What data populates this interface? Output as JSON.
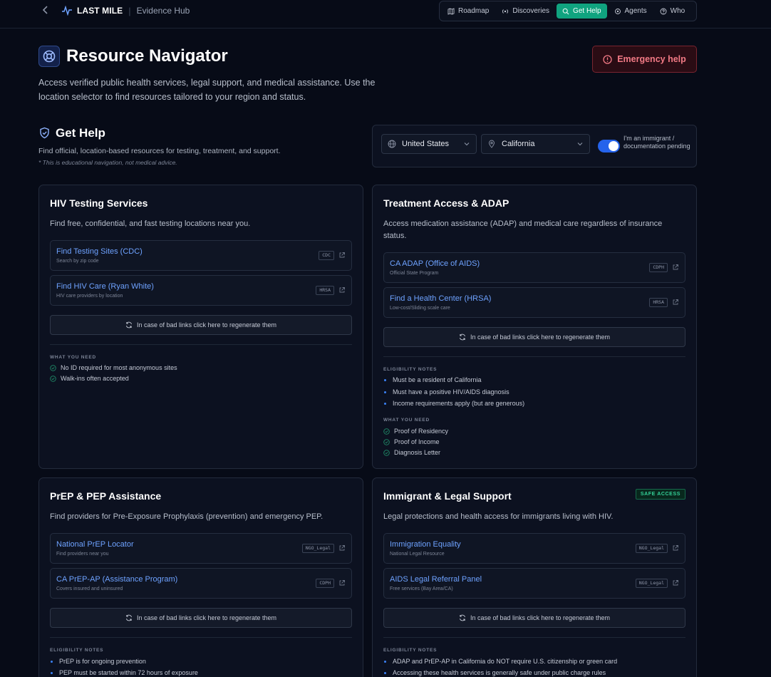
{
  "topbar": {
    "brand": "LAST MILE",
    "section": "Evidence Hub",
    "nav": [
      {
        "label": "Roadmap",
        "icon": "map-icon"
      },
      {
        "label": "Discoveries",
        "icon": "radio-icon"
      },
      {
        "label": "Get Help",
        "icon": "search-icon",
        "active": true
      },
      {
        "label": "Agents",
        "icon": "agents-icon"
      },
      {
        "label": "Who",
        "icon": "help-circle-icon"
      }
    ]
  },
  "hero": {
    "title": "Resource Navigator",
    "description": "Access verified public health services, legal support, and medical assistance. Use the location selector to find resources tailored to your region and status.",
    "emergency_label": "Emergency help"
  },
  "get_help": {
    "title": "Get Help",
    "description": "Find official, location-based resources for testing, treatment, and support.",
    "note": "* This is educational navigation, not medical advice."
  },
  "location": {
    "country": "United States",
    "state": "California",
    "toggle_on": true,
    "toggle_label": "I'm an immigrant / documentation pending"
  },
  "cards": {
    "hiv": {
      "title": "HIV Testing Services",
      "description": "Find free, confidential, and fast testing locations near you.",
      "links": [
        {
          "title": "Find Testing Sites (CDC)",
          "sub": "Search by zip code",
          "tag": "CDC"
        },
        {
          "title": "Find HIV Care (Ryan White)",
          "sub": "HIV care providers by location",
          "tag": "HRSA"
        }
      ],
      "regen": "In case of bad links click here to regenerate them",
      "need_label": "WHAT YOU NEED",
      "need": [
        "No ID required for most anonymous sites",
        "Walk-ins often accepted"
      ]
    },
    "treatment": {
      "title": "Treatment Access & ADAP",
      "description": "Access medication assistance (ADAP) and medical care regardless of insurance status.",
      "links": [
        {
          "title": "CA ADAP (Office of AIDS)",
          "sub": "Official State Program",
          "tag": "CDPH"
        },
        {
          "title": "Find a Health Center (HRSA)",
          "sub": "Low-cost/Sliding scale care",
          "tag": "HRSA"
        }
      ],
      "regen": "In case of bad links click here to regenerate them",
      "elig_label": "ELIGIBILITY NOTES",
      "elig": [
        "Must be a resident of California",
        "Must have a positive HIV/AIDS diagnosis",
        "Income requirements apply (but are generous)"
      ],
      "need_label": "WHAT YOU NEED",
      "need": [
        "Proof of Residency",
        "Proof of Income",
        "Diagnosis Letter"
      ]
    },
    "prep": {
      "title": "PrEP & PEP Assistance",
      "description": "Find providers for Pre-Exposure Prophylaxis (prevention) and emergency PEP.",
      "links": [
        {
          "title": "National PrEP Locator",
          "sub": "Find providers near you",
          "tag": "NGO_Legal"
        },
        {
          "title": "CA PrEP-AP (Assistance Program)",
          "sub": "Covers insured and uninsured",
          "tag": "CDPH"
        }
      ],
      "regen": "In case of bad links click here to regenerate them",
      "elig_label": "ELIGIBILITY NOTES",
      "elig": [
        "PrEP is for ongoing prevention",
        "PEP must be started within 72 hours of exposure"
      ]
    },
    "immigrant": {
      "title": "Immigrant & Legal Support",
      "badge": "SAFE ACCESS",
      "description": "Legal protections and health access for immigrants living with HIV.",
      "links": [
        {
          "title": "Immigration Equality",
          "sub": "National Legal Resource",
          "tag": "NGO_Legal"
        },
        {
          "title": "AIDS Legal Referral Panel",
          "sub": "Free services (Bay Area/CA)",
          "tag": "NGO_Legal"
        }
      ],
      "regen": "In case of bad links click here to regenerate them",
      "elig_label": "ELIGIBILITY NOTES",
      "elig": [
        "ADAP and PrEP-AP in California do NOT require U.S. citizenship or green card",
        "Accessing these health services is generally safe under public charge rules"
      ]
    }
  },
  "colors": {
    "accent": "#10a37f",
    "link": "#6ea2ff",
    "danger": "#f27a85",
    "safe": "#34d399"
  }
}
